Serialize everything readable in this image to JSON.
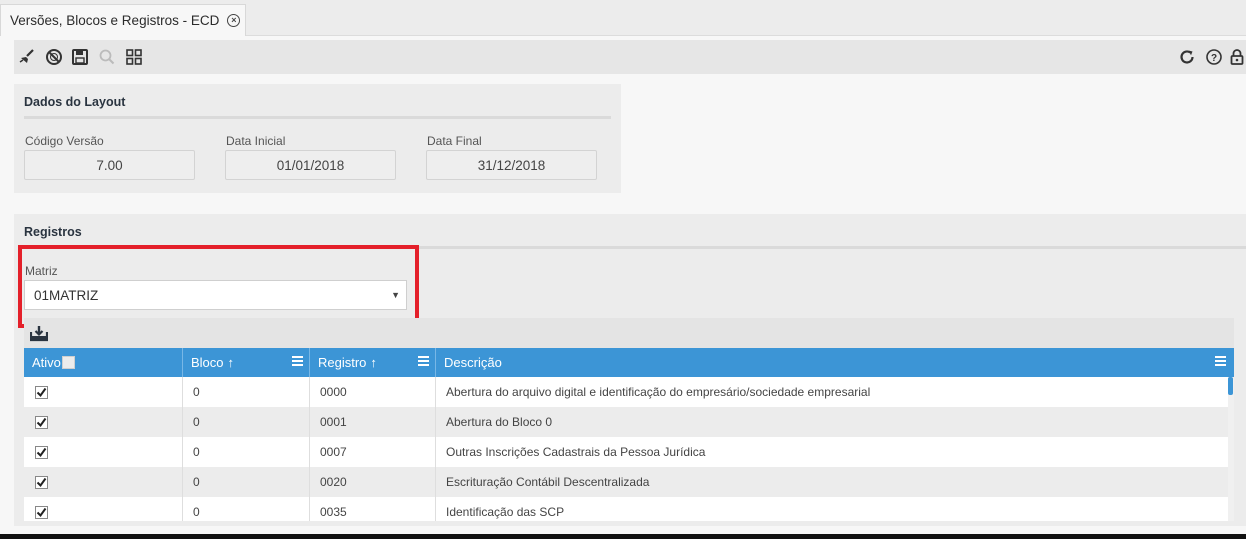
{
  "tab": {
    "title": "Versões, Blocos e Registros - ECD"
  },
  "toolbar": {
    "left_icons": [
      "broom-icon",
      "cancel-icon",
      "save-icon",
      "search-icon",
      "grid-icon"
    ],
    "right_icons": [
      "refresh-icon",
      "help-icon",
      "lock-icon"
    ]
  },
  "layout_panel": {
    "title": "Dados do Layout",
    "fields": [
      {
        "label": "Código Versão",
        "value": "7.00"
      },
      {
        "label": "Data Inicial",
        "value": "01/01/2018"
      },
      {
        "label": "Data Final",
        "value": "31/12/2018"
      }
    ]
  },
  "registros_panel": {
    "title": "Registros",
    "matriz": {
      "label": "Matriz",
      "value": "01MATRIZ"
    }
  },
  "grid": {
    "columns": [
      {
        "label": "Ativo",
        "sortable": false
      },
      {
        "label": "Bloco",
        "sortable": true
      },
      {
        "label": "Registro",
        "sortable": true
      },
      {
        "label": "Descrição",
        "sortable": false
      }
    ],
    "rows": [
      {
        "ativo": true,
        "bloco": "0",
        "registro": "0000",
        "descricao": "Abertura do arquivo digital e identificação do empresário/sociedade empresarial"
      },
      {
        "ativo": true,
        "bloco": "0",
        "registro": "0001",
        "descricao": "Abertura do Bloco 0"
      },
      {
        "ativo": true,
        "bloco": "0",
        "registro": "0007",
        "descricao": "Outras Inscrições Cadastrais da Pessoa Jurídica"
      },
      {
        "ativo": true,
        "bloco": "0",
        "registro": "0020",
        "descricao": "Escrituração Contábil Descentralizada"
      },
      {
        "ativo": true,
        "bloco": "0",
        "registro": "0035",
        "descricao": "Identificação das SCP"
      }
    ]
  },
  "colors": {
    "accent": "#3c95d6",
    "highlight": "#e4202a"
  }
}
